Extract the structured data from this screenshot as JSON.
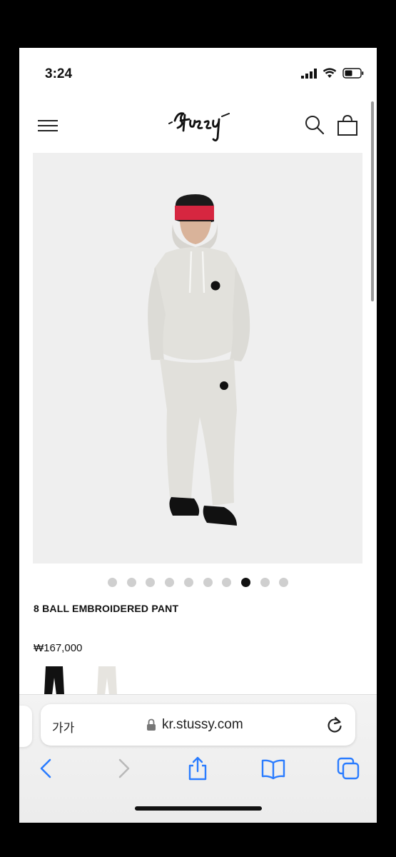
{
  "status": {
    "time": "3:24"
  },
  "header": {
    "logo_text": "Stüssy"
  },
  "product": {
    "title": "8 BALL EMBROIDERED PANT",
    "price": "₩167,000",
    "gallery_count": 10,
    "gallery_active_index": 7,
    "swatches": [
      {
        "name": "black",
        "color": "#111111"
      },
      {
        "name": "ash heather",
        "color": "#e6e4df"
      }
    ]
  },
  "browser": {
    "aa_label": "가가",
    "url": "kr.stussy.com"
  },
  "colors": {
    "image_bg": "#efefef",
    "hoodie": "#e2e1dc",
    "beanie": "#d62640",
    "accent_link": "#2a7cff"
  }
}
